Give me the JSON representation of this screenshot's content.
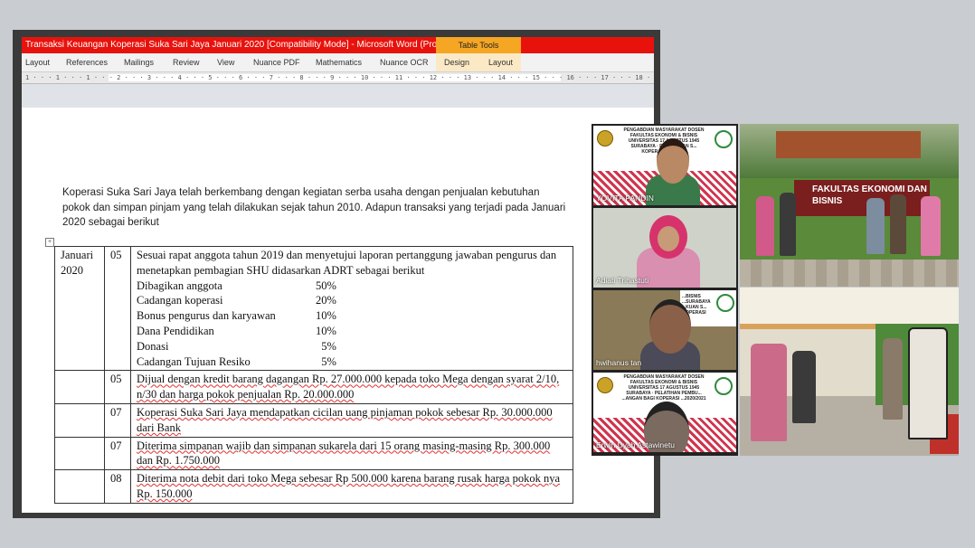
{
  "word": {
    "title": "Transaksi Keuangan Koperasi Suka Sari Jaya Januari 2020 [Compatibility Mode]  -  Microsoft Word (Product Ac...",
    "context_tab": "Table Tools",
    "tabs": [
      "Layout",
      "References",
      "Mailings",
      "Review",
      "View",
      "Nuance PDF",
      "Mathematics",
      "Nuance OCR",
      "Design",
      "Layout"
    ],
    "ruler": "1 · · · 1 · · · 1 · · · 2 · · · 3 · · · 4 · · · 5 · · · 6 · · · 7 · · · 8 · · · 9 · · · 10 · · · 11 · · · 12 · · · 13 · · · 14 · · · 15 · · · 16 · · · 17 · · · 18 · · · 19",
    "intro": "Koperasi Suka Sari Jaya telah berkembang dengan kegiatan serba usaha dengan penjualan kebutuhan pokok dan simpan pinjam yang telah dilakukan sejak tahun 2010. Adapun transaksi yang terjadi pada Januari 2020 sebagai berikut",
    "table": {
      "date_month": "Januari",
      "date_year": "2020",
      "row1": {
        "day": "05",
        "text": "Sesuai rapat anggota tahun 2019 dan menyetujui laporan pertanggung jawaban pengurus dan menetapkan pembagian SHU didasarkan ADRT sebagai berikut",
        "alloc": [
          {
            "label": "Dibagikan anggota",
            "pct": "50%"
          },
          {
            "label": "Cadangan koperasi",
            "pct": "20%"
          },
          {
            "label": "Bonus pengurus dan karyawan",
            "pct": "10%"
          },
          {
            "label": "Dana Pendidikan",
            "pct": "10%"
          },
          {
            "label": "Donasi",
            "pct": "  5%"
          },
          {
            "label": "Cadangan Tujuan Resiko",
            "pct": "  5%"
          }
        ]
      },
      "rows": [
        {
          "day": "05",
          "text": "Dijual dengan kredit barang dagangan Rp. 27.000.000 kepada toko Mega dengan syarat 2/10, n/30 dan harga pokok penjualan Rp. 20.000.000"
        },
        {
          "day": "07",
          "text": "Koperasi Suka Sari Jaya mendapatkan cicilan uang pinjaman pokok sebesar Rp. 30.000.000 dari Bank"
        },
        {
          "day": "07",
          "text": "Diterima simpanan wajib dan simpanan sukarela dari 15 orang masing-masing Rp. 300.000 dan Rp. 1.750.000"
        },
        {
          "day": "08",
          "text": "Diterima nota debit dari toko Mega  sebesar Rp 500.000 karena barang rusak harga pokok nya Rp. 150.000"
        }
      ]
    }
  },
  "zoom": {
    "participants": [
      {
        "name": "YOVITA PANDIN",
        "banner": "PENGABDIAN MASYARAKAT DOSEN FAKULTAS EKONOMI & BISNIS UNIVERSITAS 17 AGUSTUS 1945 SURABAYA · PEMBUKUAN S... KOPERASI SEMES..."
      },
      {
        "name": "Adiati Trihastuti",
        "banner": ""
      },
      {
        "name": "hwihanus tan",
        "banner": "...BISNIS ...SURABAYA ...KUAN S... ...OPERASI"
      },
      {
        "name": "Erwin Dyah Astawinetu",
        "banner": "PENGABDIAN MASYARAKAT DOSEN FAKULTAS EKONOMI & BISNIS UNIVERSITAS 17 AGUSTUS 1945 SURABAYA · PELATIHAN PEMBU... ...ANGAN BAGI KOPERASI ...2020/2021"
      }
    ]
  },
  "photos": {
    "sign_text": "FAKULTAS EKONOMI DAN BISNIS"
  },
  "colors": {
    "titlebar": "#e8120c",
    "context_tab": "#f5a623",
    "backdrop": "#c9ccd1"
  }
}
